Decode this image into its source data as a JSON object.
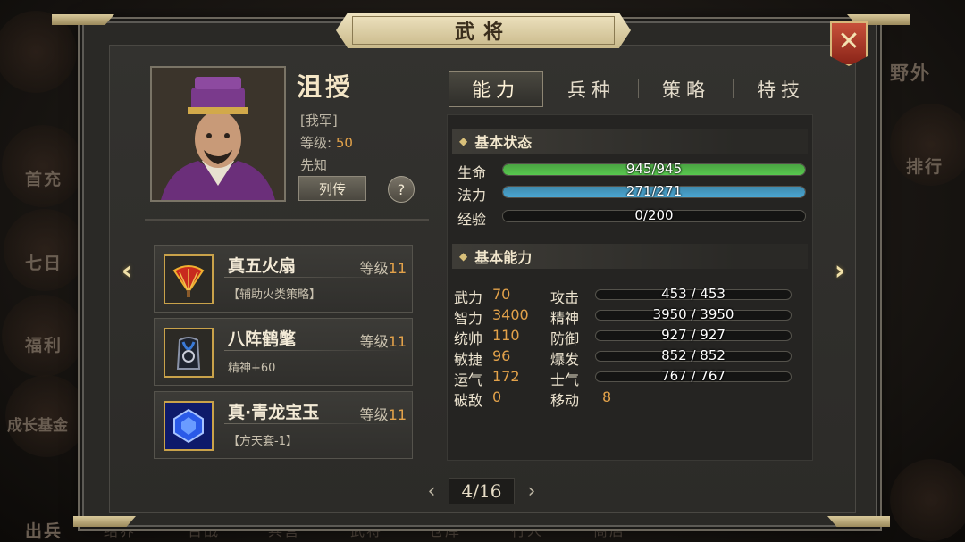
{
  "window": {
    "title": "武将"
  },
  "background": {
    "right_labels": [
      "野外",
      "排行"
    ],
    "left_labels": [
      "首充",
      "七日",
      "福利",
      "成长基金",
      "出兵"
    ],
    "bottom_tabs": [
      "结界",
      "百战",
      "兵营",
      "武将",
      "仓库",
      "行人",
      "商店"
    ]
  },
  "general": {
    "name": "沮授",
    "faction": "[我军]",
    "level_label": "等级:",
    "level_value": "50",
    "trait": "先知",
    "bio_button": "列传",
    "help_button": "?"
  },
  "equipment": [
    {
      "name": "真五火扇",
      "level_label": "等级",
      "level": "11",
      "desc": "【辅助火类策略】",
      "icon": "fan-icon"
    },
    {
      "name": "八阵鹤氅",
      "level_label": "等级",
      "level": "11",
      "desc": "精神+60",
      "icon": "cloak-icon"
    },
    {
      "name": "真·青龙宝玉",
      "level_label": "等级",
      "level": "11",
      "desc": "【方天套-1】",
      "icon": "gem-icon"
    }
  ],
  "pager": {
    "text": "4/16",
    "prev": "‹",
    "next": "›"
  },
  "tabs": [
    {
      "label": "能力",
      "active": true
    },
    {
      "label": "兵种",
      "active": false
    },
    {
      "label": "策略",
      "active": false
    },
    {
      "label": "特技",
      "active": false
    }
  ],
  "basic_status": {
    "title": "基本状态",
    "bars": [
      {
        "label": "生命",
        "text": "945/945",
        "fill": 1.0,
        "color": "#58c84e"
      },
      {
        "label": "法力",
        "text": "271/271",
        "fill": 1.0,
        "color": "#4aa6d2"
      },
      {
        "label": "经验",
        "text": "0/200",
        "fill": 0.0,
        "color": "#4aa6d2"
      }
    ]
  },
  "basic_ability": {
    "title": "基本能力",
    "rows": [
      {
        "a_label": "武力",
        "a_value": "70",
        "c_label": "攻击",
        "c_text": "453 / 453",
        "fill": 0.22
      },
      {
        "a_label": "智力",
        "a_value": "3400",
        "c_label": "精神",
        "c_text": "3950 / 3950",
        "fill": 0.97
      },
      {
        "a_label": "统帅",
        "a_value": "110",
        "c_label": "防御",
        "c_text": "927 / 927",
        "fill": 0.47
      },
      {
        "a_label": "敏捷",
        "a_value": "96",
        "c_label": "爆发",
        "c_text": "852 / 852",
        "fill": 0.43
      },
      {
        "a_label": "运气",
        "a_value": "172",
        "c_label": "士气",
        "c_text": "767 / 767",
        "fill": 0.39
      },
      {
        "a_label": "破敌",
        "a_value": "0",
        "c_label": "移动",
        "c_value": "8"
      }
    ]
  },
  "colors": {
    "accent_gold": "#e3a24a",
    "hp_green": "#58c84e",
    "mp_blue": "#4aa6d2",
    "close_red": "#b03a28"
  }
}
